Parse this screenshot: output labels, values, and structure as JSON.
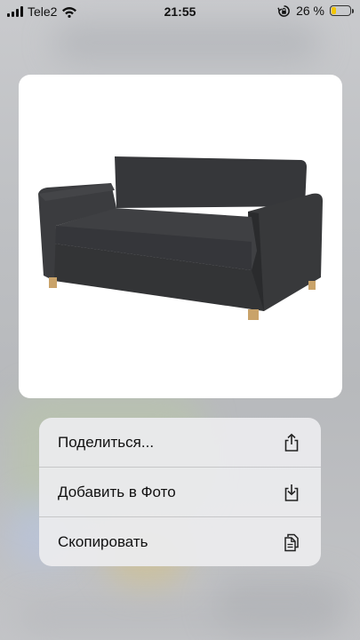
{
  "status_bar": {
    "carrier": "Tele2",
    "time": "21:55",
    "battery_percent": "26 %",
    "battery_level": 0.26,
    "signal_bars": 4
  },
  "preview": {
    "subject_icon": "sofa-image"
  },
  "context_menu": {
    "items": [
      {
        "label": "Поделиться...",
        "icon": "share-icon"
      },
      {
        "label": "Добавить в Фото",
        "icon": "save-to-photos-icon"
      },
      {
        "label": "Скопировать",
        "icon": "copy-icon"
      }
    ]
  },
  "colors": {
    "battery_fill": "#f3c600",
    "menu_background": "#ececee",
    "sofa": "#3a3b3d"
  }
}
